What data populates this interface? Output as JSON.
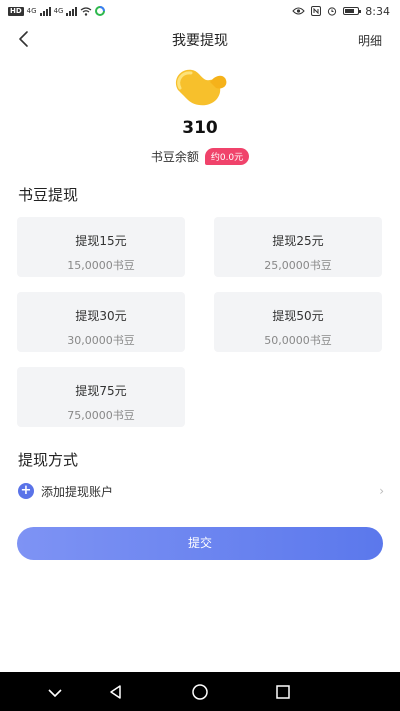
{
  "status_bar": {
    "hd": "HD",
    "network_1": "4G",
    "network_2": "4G",
    "time": "8:34"
  },
  "header": {
    "title": "我要提现",
    "detail_label": "明细"
  },
  "balance": {
    "value": "310",
    "label": "书豆余额",
    "approx": "约0.0元"
  },
  "withdraw_section": {
    "title": "书豆提现",
    "options": [
      {
        "amount": "提现15元",
        "beans": "15,0000书豆"
      },
      {
        "amount": "提现25元",
        "beans": "25,0000书豆"
      },
      {
        "amount": "提现30元",
        "beans": "30,0000书豆"
      },
      {
        "amount": "提现50元",
        "beans": "50,0000书豆"
      },
      {
        "amount": "提现75元",
        "beans": "75,0000书豆"
      }
    ]
  },
  "method_section": {
    "title": "提现方式",
    "add_account": "添加提现账户"
  },
  "submit_label": "提交",
  "colors": {
    "accent": "#5b78ec",
    "badge": "#f0436b",
    "coin": "#f7c02c"
  },
  "icons": [
    "back-arrow-icon",
    "coin-icon",
    "plus-icon",
    "chevron-right-icon",
    "eye-icon",
    "nfc-icon",
    "alarm-icon",
    "battery-icon",
    "wifi-icon"
  ]
}
